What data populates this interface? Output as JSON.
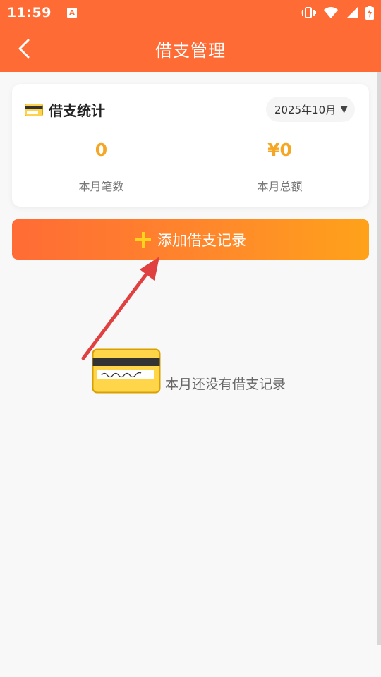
{
  "status_bar": {
    "time": "11:59",
    "notification_icon": "A",
    "icons": [
      "vibrate-icon",
      "wifi-icon",
      "signal-icon",
      "battery-charging-icon"
    ]
  },
  "header": {
    "title": "借支管理",
    "back_icon": "back-chevron-icon"
  },
  "stats": {
    "title": "借支统计",
    "title_icon": "credit-card-icon",
    "month_label": "2025年10月",
    "count_value": "0",
    "count_label": "本月笔数",
    "total_value": "¥0",
    "total_label": "本月总额"
  },
  "actions": {
    "add_label": "添加借支记录",
    "add_icon": "plus-icon"
  },
  "empty_state": {
    "text": "本月还没有借支记录",
    "icon": "credit-card-icon"
  },
  "colors": {
    "primary": "#ff6b35",
    "accent_yellow": "#f5a623",
    "annotation_red": "#e04040"
  }
}
